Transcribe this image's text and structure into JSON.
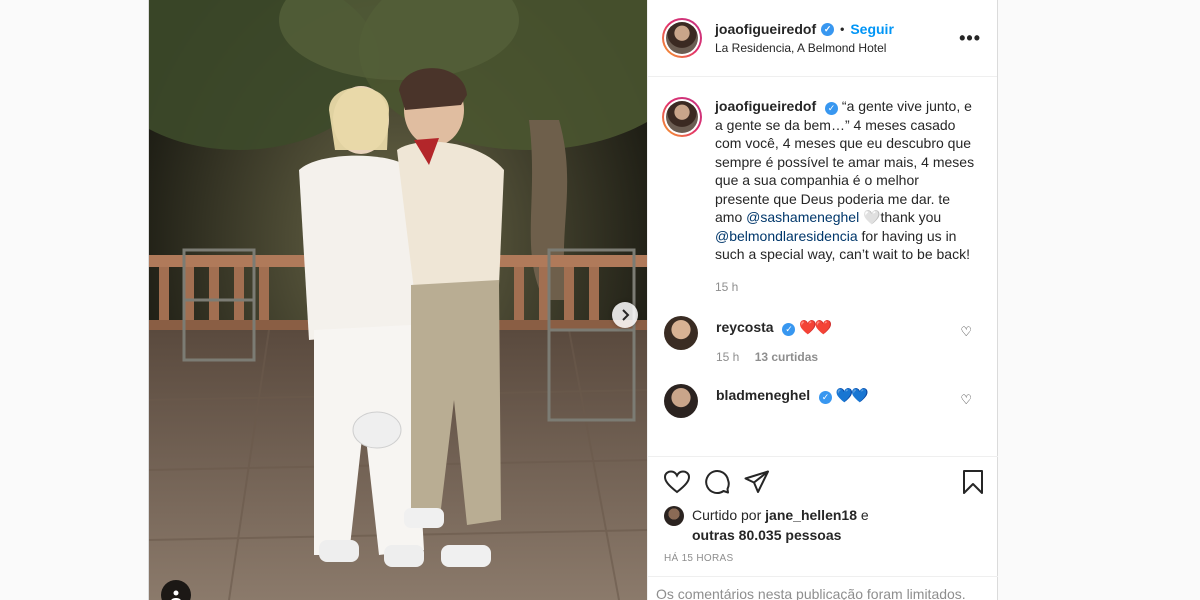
{
  "header": {
    "username": "joaofigueiredof",
    "separator": "•",
    "follow_label": "Seguir",
    "location": "La Residencia, A Belmond Hotel",
    "more_label": "•••"
  },
  "caption": {
    "username": "joaofigueiredof",
    "text_1": "“a gente vive junto, e a gente se da bem…” 4 meses casado com você, 4 meses que eu descubro que sempre é possível te amar mais, 4 meses que a sua companhia é o melhor presente que Deus poderia me dar. te amo",
    "mention_1": "@sashameneghel",
    "text_2": " 🤍thank you",
    "mention_2": "@belmondlaresidencia",
    "text_3": " for having us in such a special way, can’t wait to be back!",
    "time": "15 h"
  },
  "comments": [
    {
      "username": "reycosta",
      "text": "❤️❤️",
      "time": "15 h",
      "likes": "13 curtidas"
    },
    {
      "username": "bladmeneghel",
      "text": "💙💙"
    }
  ],
  "likes": {
    "prefix": "Curtido por ",
    "user": "jane_hellen18",
    "middle": " e",
    "others": "outras 80.035 pessoas"
  },
  "posted_ago": "HÁ 15 HORAS",
  "comments_limited": "Os comentários nesta publicação foram limitados.",
  "colors": {
    "link": "#0095f6",
    "verified": "#3897f0",
    "muted": "#8e8e8e"
  },
  "icons": [
    "verified-badge-icon",
    "more-options-icon",
    "heart-icon",
    "comment-icon",
    "share-icon",
    "bookmark-icon",
    "chevron-right-icon",
    "user-tag-icon"
  ]
}
